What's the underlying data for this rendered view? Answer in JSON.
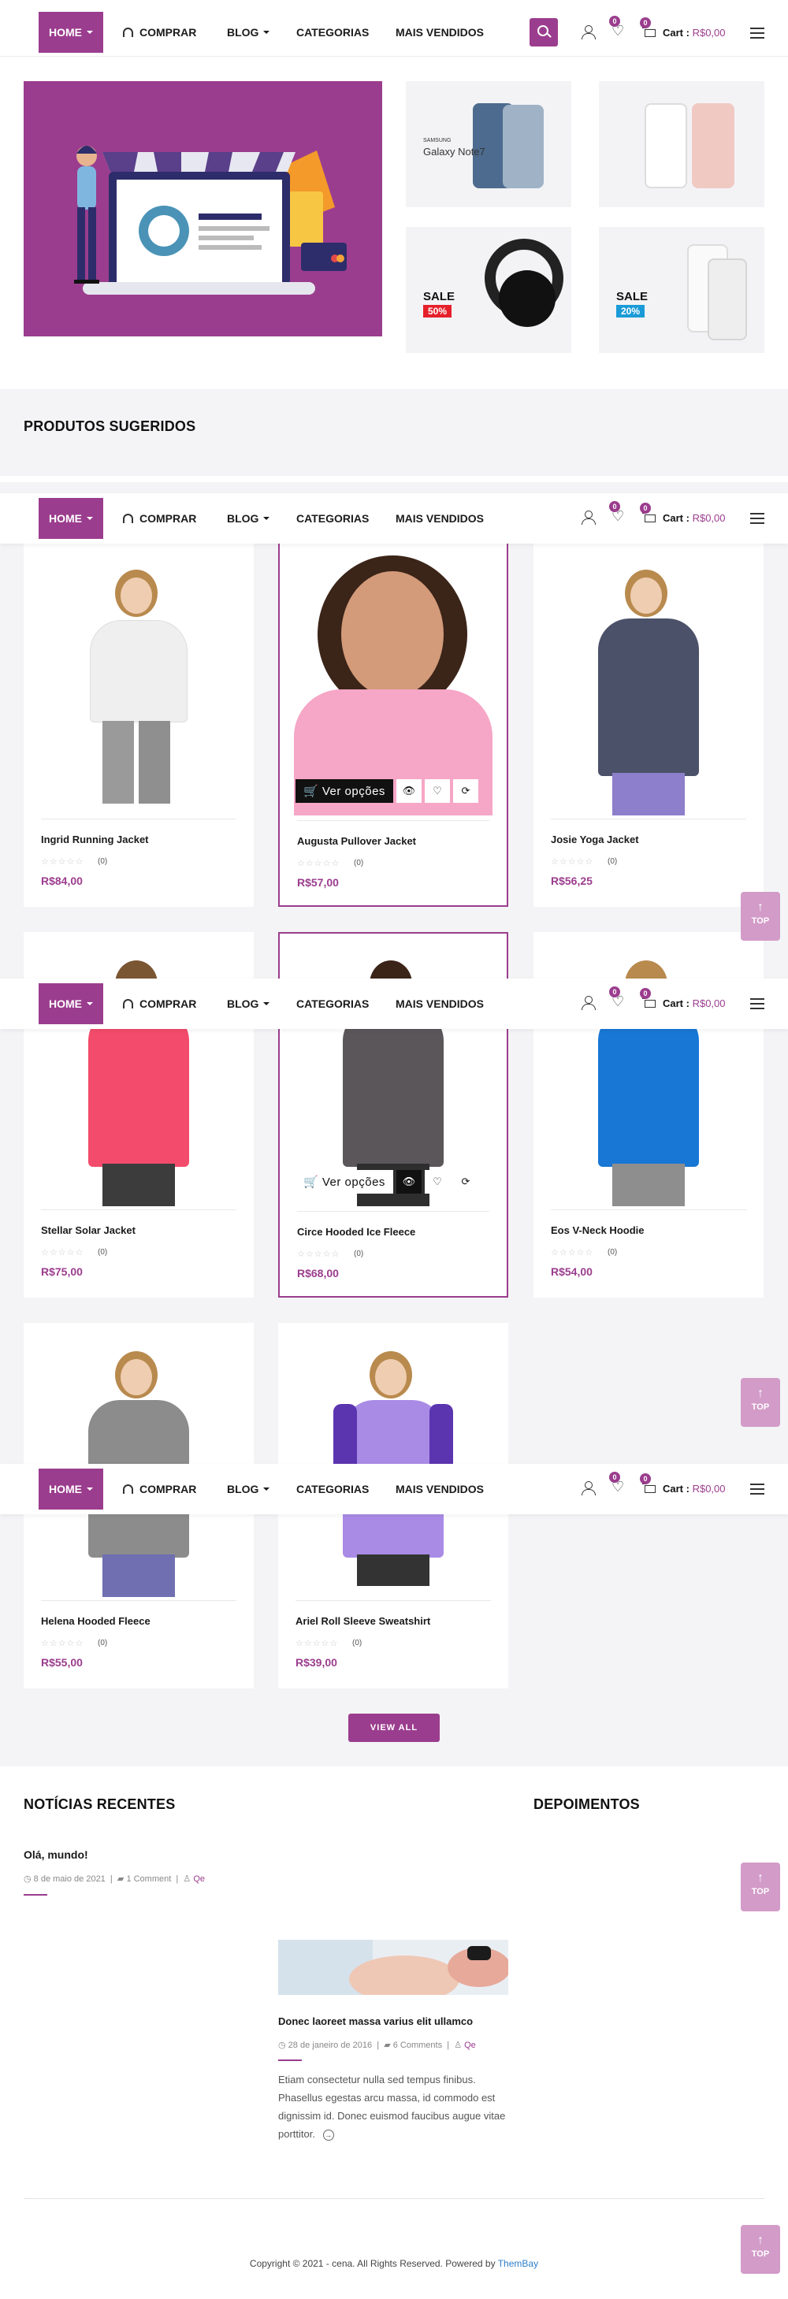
{
  "nav": {
    "home": "HOME",
    "comprar": "COMPRAR",
    "blog": "BLOG",
    "categorias": "CATEGORIAS",
    "mais_vendidos": "MAIS VENDIDOS",
    "wishlist_count": "0",
    "cart_count": "0",
    "cart_label": "Cart :",
    "cart_amount": "R$0,00"
  },
  "hero": {
    "phone_brand": "SAMSUNG",
    "phone_model": "Galaxy Note7",
    "sale_1_text": "SALE",
    "sale_1_pct": "50%",
    "sale_2_text": "SALE",
    "sale_2_pct": "20%"
  },
  "suggested": {
    "title": "PRODUTOS SUGERIDOS",
    "view_options": "Ver opções",
    "products": [
      {
        "name": "Ingrid Running Jacket",
        "price": "R$84,00",
        "reviews": "(0)"
      },
      {
        "name": "Augusta Pullover Jacket",
        "price": "R$57,00",
        "reviews": "(0)"
      },
      {
        "name": "Josie Yoga Jacket",
        "price": "R$56,25",
        "reviews": "(0)"
      },
      {
        "name": "Stellar Solar Jacket",
        "price": "R$75,00",
        "reviews": "(0)"
      },
      {
        "name": "Circe Hooded Ice Fleece",
        "price": "R$68,00",
        "reviews": "(0)"
      },
      {
        "name": "Eos V-Neck Hoodie",
        "price": "R$54,00",
        "reviews": "(0)"
      },
      {
        "name": "Helena Hooded Fleece",
        "price": "R$55,00",
        "reviews": "(0)"
      },
      {
        "name": "Ariel Roll Sleeve Sweatshirt",
        "price": "R$39,00",
        "reviews": "(0)"
      }
    ],
    "view_all": "VIEW ALL"
  },
  "top_label": "TOP",
  "news": {
    "title": "NOTÍCIAS RECENTES",
    "post1": {
      "title": "Olá, mundo!",
      "date": "8 de maio de 2021",
      "comments": "1 Comment",
      "author": "Qe"
    },
    "post2": {
      "title": "Donec laoreet massa varius elit ullamco",
      "date": "28 de janeiro de 2016",
      "comments": "6 Comments",
      "author": "Qe",
      "excerpt": "Etiam consectetur nulla sed tempus finibus. Phasellus egestas arcu massa, id commodo est dignissim id. Donec euismod faucibus augue vitae porttitor."
    }
  },
  "testimonials": {
    "title": "DEPOIMENTOS"
  },
  "footer": {
    "text": "Copyright © 2021 - cena. All Rights Reserved. Powered by ",
    "link": "ThemBay"
  },
  "colors": {
    "accent": "#9b3d8e",
    "top_button": "#d29bc8",
    "band": "#f4f4f6"
  }
}
